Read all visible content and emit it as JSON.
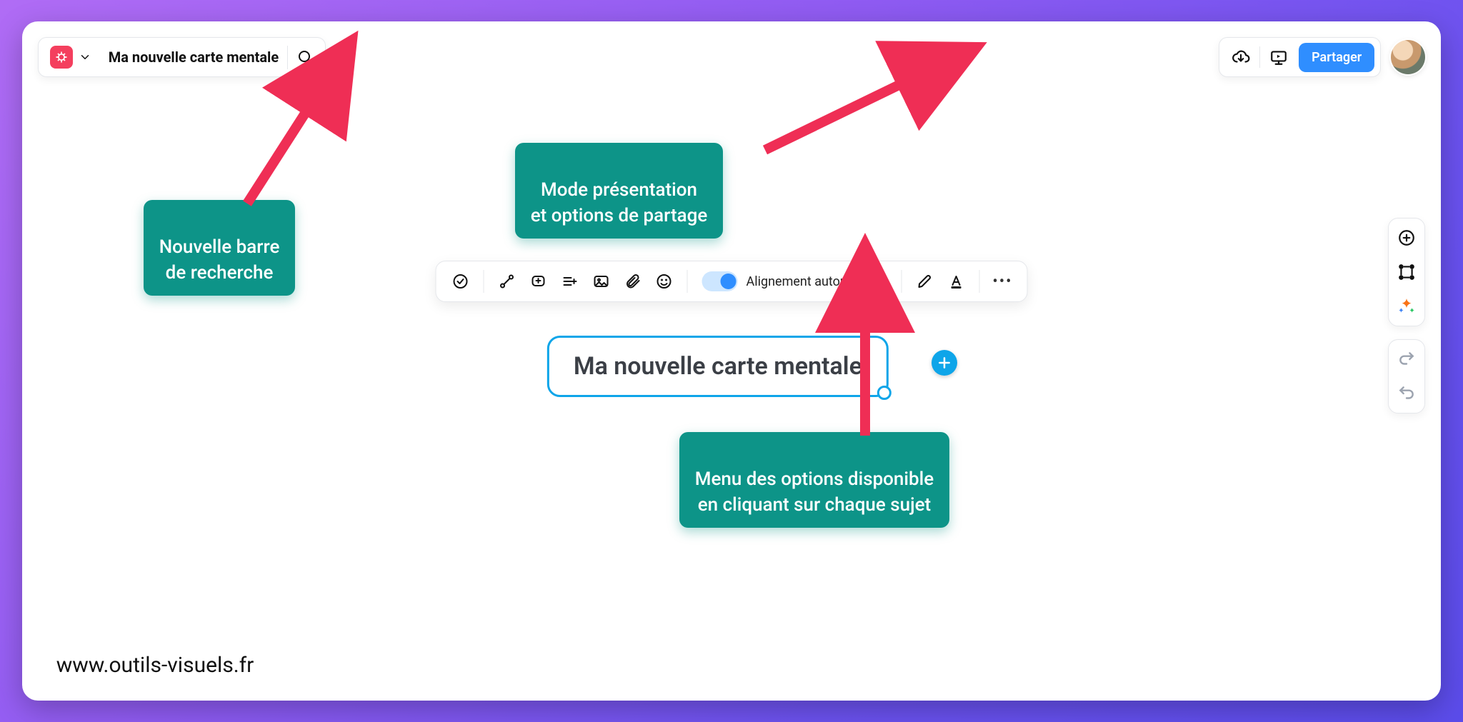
{
  "header": {
    "title": "Ma nouvelle carte mentale",
    "share_label": "Partager"
  },
  "node_toolbar": {
    "auto_align_label": "Alignement automatique"
  },
  "center_node": {
    "text": "Ma nouvelle carte mentale"
  },
  "callouts": {
    "search": "Nouvelle barre\nde recherche",
    "share": "Mode présentation\net options de partage",
    "options": "Menu des options disponible\nen cliquant sur chaque sujet"
  },
  "watermark": "www.outils-visuels.fr"
}
